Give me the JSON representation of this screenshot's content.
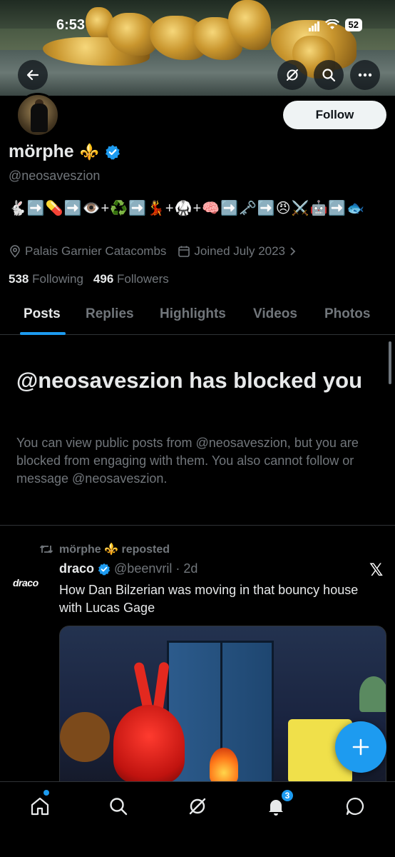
{
  "status_bar": {
    "time": "6:53",
    "battery": "52"
  },
  "profile": {
    "display_name": "mörphe",
    "name_emoji": "⚜️",
    "handle": "@neosaveszion",
    "bio": "🐇➡️💊➡️👁️+♻️➡️💃+🥋+🧠➡️🗝️➡️😠⚔️🤖➡️🐟",
    "location": "Palais Garnier Catacombs",
    "joined": "Joined July 2023",
    "following_count": "538",
    "following_label": "Following",
    "followers_count": "496",
    "followers_label": "Followers",
    "follow_label": "Follow"
  },
  "tabs": [
    "Posts",
    "Replies",
    "Highlights",
    "Videos",
    "Photos"
  ],
  "blocked": {
    "title": "@neosaveszion has blocked you",
    "text": "You can view public posts from @neosaveszion, but you are blocked from engaging with them. You also cannot follow or message @neosaveszion."
  },
  "post": {
    "repost_label": "mörphe ⚜️ reposted",
    "avatar_text": "draco",
    "author": "draco",
    "handle": "@beenvril",
    "time": "2d",
    "text": "How Dan Bilzerian was moving in that bouncy house with Lucas Gage"
  },
  "nav": {
    "notifications_badge": "3"
  },
  "colors": {
    "accent": "#1d9bf0",
    "background": "#000000",
    "muted": "#71767b"
  },
  "icons": [
    "back-arrow-icon",
    "grok-icon",
    "search-icon",
    "more-icon",
    "verified-icon",
    "location-icon",
    "calendar-icon",
    "repost-icon",
    "x-logo-icon",
    "plus-icon",
    "home-icon",
    "notifications-icon",
    "messages-icon"
  ]
}
